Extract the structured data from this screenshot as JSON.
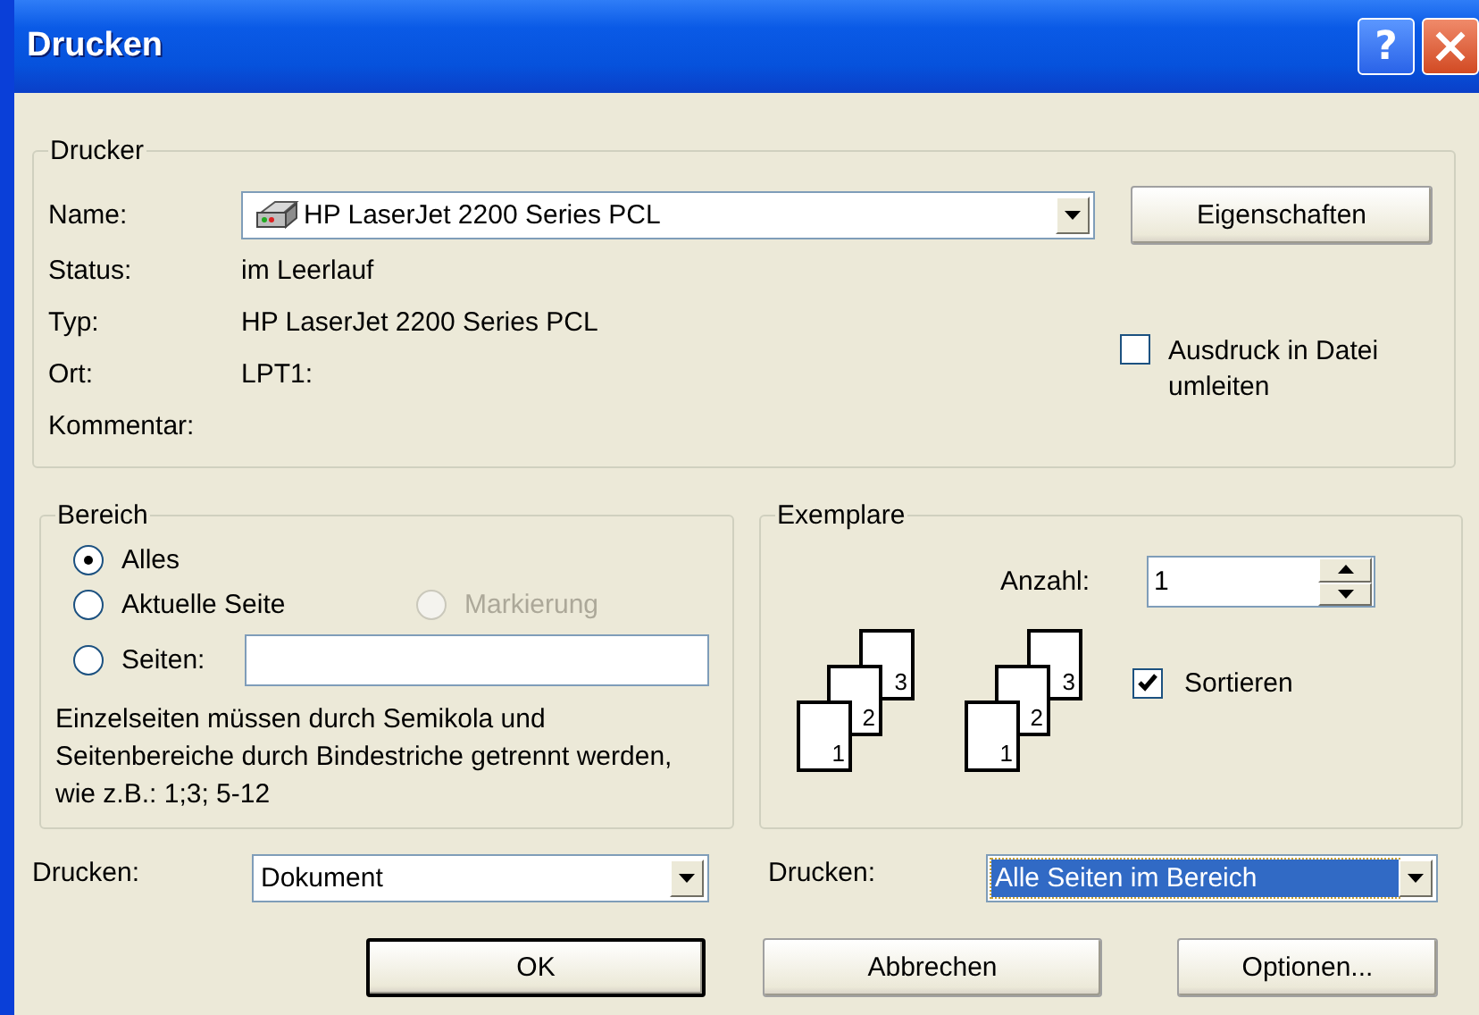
{
  "window": {
    "title": "Drucken",
    "help_button": "?"
  },
  "printer": {
    "legend": "Drucker",
    "name_label": "Name:",
    "name_value": "HP LaserJet 2200 Series PCL",
    "properties_button": "Eigenschaften",
    "details": [
      {
        "label": "Status:",
        "value": "im Leerlauf"
      },
      {
        "label": "Typ:",
        "value": "HP LaserJet 2200 Series PCL"
      },
      {
        "label": "Ort:",
        "value": "LPT1:"
      },
      {
        "label": "Kommentar:"
      }
    ],
    "print_to_file": {
      "label": "Ausdruck in Datei umleiten",
      "checked": false
    }
  },
  "range": {
    "legend": "Bereich",
    "options": [
      {
        "label": "Alles",
        "selected": true,
        "disabled": false
      },
      {
        "label": "Aktuelle Seite",
        "selected": false,
        "disabled": false
      },
      {
        "label": "Markierung",
        "selected": false,
        "disabled": true
      },
      {
        "label": "Seiten:",
        "selected": false,
        "disabled": false
      }
    ],
    "hint": "Einzelseiten müssen durch Semikola und Seitenbereiche durch Bindestriche getrennt werden, wie z.B.: 1;3; 5-12"
  },
  "copies": {
    "legend": "Exemplare",
    "count_label": "Anzahl:",
    "count": "1",
    "stacks": [
      {
        "pages": [
          "1",
          "2",
          "3"
        ]
      },
      {
        "pages": [
          "1",
          "2",
          "3"
        ]
      }
    ],
    "collate": {
      "label": "Sortieren",
      "checked": true
    }
  },
  "print_what": [
    {
      "label": "Drucken:",
      "value": "Dokument",
      "focused": false
    },
    {
      "label": "Drucken:",
      "value": "Alle Seiten im Bereich",
      "focused": true
    }
  ],
  "buttons": [
    {
      "label": "OK",
      "default": true
    },
    {
      "label": "Abbrechen",
      "default": false
    },
    {
      "label": "Optionen...",
      "default": false
    }
  ]
}
